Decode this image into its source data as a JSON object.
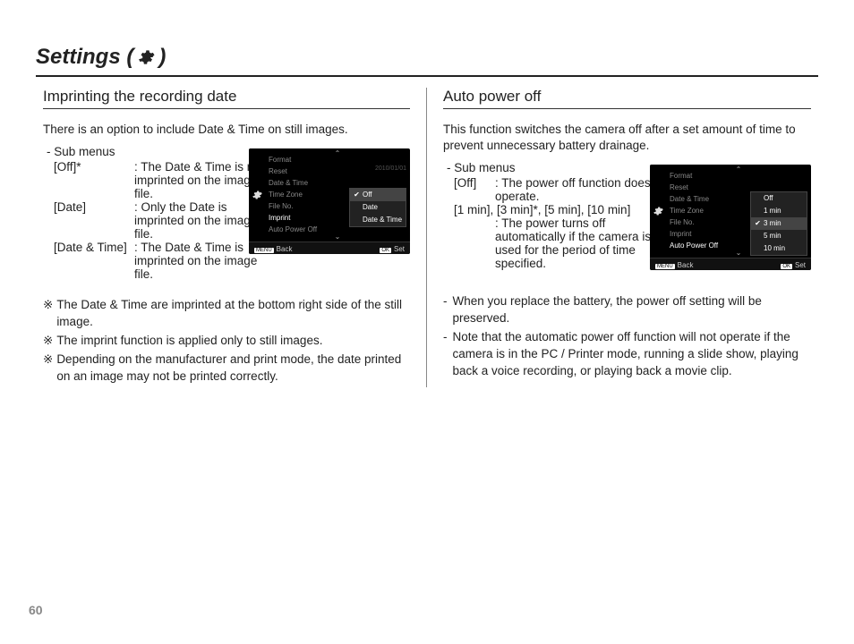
{
  "page_number": "60",
  "title": "Settings (",
  "title_close": ")",
  "left": {
    "heading": "Imprinting the recording date",
    "intro": "There is an option to include Date & Time on still images.",
    "submenu_label": "- Sub menus",
    "rows": [
      {
        "term": "[Off]*",
        "desc": ": The Date & Time is not imprinted on the image file."
      },
      {
        "term": "[Date]",
        "desc": ": Only the Date is imprinted on the image file."
      },
      {
        "term": "[Date & Time]",
        "desc": ": The Date & Time is imprinted on the image file."
      }
    ],
    "notes": [
      "The Date & Time are imprinted at the bottom right side of the still image.",
      "The imprint function is applied only to still images.",
      "Depending on the manufacturer and print mode, the date printed on an image may not be printed correctly."
    ],
    "note_mark": "※",
    "lcd": {
      "menu": [
        "Format",
        "Reset",
        "Date & Time",
        "Time Zone",
        "File No.",
        "Imprint",
        "Auto Power Off"
      ],
      "date_val": "2010/01/01",
      "current": "Imprint",
      "options": [
        {
          "label": "Off",
          "selected": true
        },
        {
          "label": "Date",
          "selected": false
        },
        {
          "label": "Date & Time",
          "selected": false
        }
      ],
      "back_btn": "MENU",
      "back": "Back",
      "set_btn": "OK",
      "set": "Set"
    }
  },
  "right": {
    "heading": "Auto power off",
    "intro": "This function switches the camera off after a set amount of time to prevent unnecessary battery drainage.",
    "submenu_label": "- Sub menus",
    "off_term": "[Off]",
    "off_desc": ": The power off function does not operate.",
    "times_line": "[1 min], [3 min]*, [5 min], [10 min]",
    "times_desc": ": The power turns off automatically if the camera is not used for the period of time specified.",
    "dash_notes": [
      "When you replace the battery, the power off setting will be preserved.",
      "Note that the automatic power off function will not operate if the camera is in the PC / Printer mode, running a slide show, playing back a voice recording, or playing back a movie clip."
    ],
    "lcd": {
      "menu": [
        "Format",
        "Reset",
        "Date & Time",
        "Time Zone",
        "File No.",
        "Imprint",
        "Auto Power Off"
      ],
      "current": "Auto Power Off",
      "options": [
        {
          "label": "Off",
          "selected": false
        },
        {
          "label": "1 min",
          "selected": false
        },
        {
          "label": "3 min",
          "selected": true
        },
        {
          "label": "5 min",
          "selected": false
        },
        {
          "label": "10 min",
          "selected": false
        }
      ],
      "back_btn": "MENU",
      "back": "Back",
      "set_btn": "OK",
      "set": "Set"
    }
  }
}
